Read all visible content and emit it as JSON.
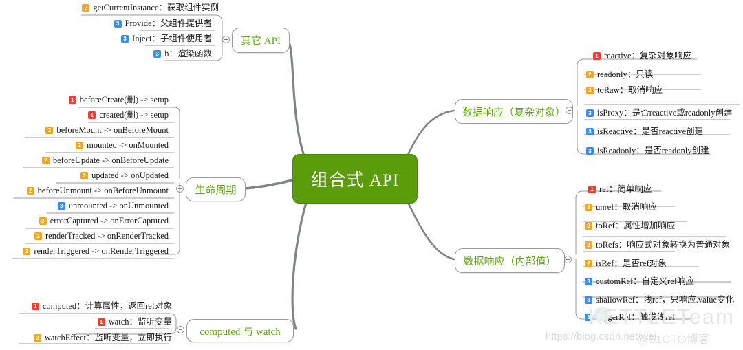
{
  "root": {
    "label": "组合式 API"
  },
  "colors": {
    "root_bg": "#5a9c0a",
    "branch_text": "#62a80f",
    "badge_p1": "#ea3f35",
    "badge_p2": "#f4a623",
    "badge_p3": "#3b8cf0",
    "connector": "#7f8486"
  },
  "branches": [
    {
      "id": "other-api",
      "label": "其它 API",
      "side": "left",
      "items": [
        {
          "priority": "2",
          "text": "getCurrentInstance：获取组件实例"
        },
        {
          "priority": "3",
          "text": "Provide：父组件提供者"
        },
        {
          "priority": "3",
          "text": "Inject：子组件使用者"
        },
        {
          "priority": "3",
          "text": "h：渲染函数"
        }
      ]
    },
    {
      "id": "lifecycle",
      "label": "生命周期",
      "side": "left",
      "items": [
        {
          "priority": "1",
          "text": "beforeCreate(删) -> setup"
        },
        {
          "priority": "1",
          "text": "created(删) -> setup"
        },
        {
          "priority": "2",
          "text": "beforeMount -> onBeforeMount"
        },
        {
          "priority": "2",
          "text": "mounted -> onMounted"
        },
        {
          "priority": "2",
          "text": "beforeUpdate -> onBeforeUpdate"
        },
        {
          "priority": "2",
          "text": "updated -> onUpdated"
        },
        {
          "priority": "2",
          "text": "beforeUnmount -> onBeforeUnmount"
        },
        {
          "priority": "3",
          "text": "unmounted -> onUnmounted"
        },
        {
          "priority": "2",
          "text": "errorCaptured -> onErrorCaptured"
        },
        {
          "priority": "2",
          "text": "renderTracked -> onRenderTracked"
        },
        {
          "priority": "2",
          "text": "renderTriggered -> onRenderTriggered"
        }
      ]
    },
    {
      "id": "computed-watch",
      "label": "computed 与 watch",
      "side": "left",
      "items": [
        {
          "priority": "1",
          "text": "computed：计算属性，返回ref对象"
        },
        {
          "priority": "1",
          "text": "watch：监听变量"
        },
        {
          "priority": "2",
          "text": "watchEffect：监听变量，立即执行"
        }
      ]
    },
    {
      "id": "reactive-object",
      "label": "数据响应（复杂对象）",
      "side": "right",
      "items": [
        {
          "priority": "1",
          "text": "reactive：复杂对象响应"
        },
        {
          "priority": "2",
          "text": "readonly：只读"
        },
        {
          "priority": "2",
          "text": "toRaw：取消响应"
        },
        {
          "priority": "3",
          "text": "isProxy：是否reactive或readonly创建"
        },
        {
          "priority": "3",
          "text": "isReactive：是否reactive创建"
        },
        {
          "priority": "3",
          "text": "isReadonly：是否readonly创建"
        }
      ]
    },
    {
      "id": "reactive-value",
      "label": "数据响应（内部值）",
      "side": "right",
      "items": [
        {
          "priority": "1",
          "text": "ref：简单响应"
        },
        {
          "priority": "2",
          "text": "unref：取消响应"
        },
        {
          "priority": "2",
          "text": "toRef：属性增加响应"
        },
        {
          "priority": "2",
          "text": "toRefs：响应式对象转换为普通对象"
        },
        {
          "priority": "2",
          "text": "isRef：是否ref对象"
        },
        {
          "priority": "3",
          "text": "customRef：自定义ref响应"
        },
        {
          "priority": "3",
          "text": "shallowRef：浅ref，只响应.value变化"
        },
        {
          "priority": "3",
          "text": "triggerRef：触发浅ref"
        }
      ]
    }
  ],
  "watermarks": {
    "csdn": "https://blog.csdn.net/wei",
    "cto": "@51CTO博客",
    "kettle": "KETTLETeam"
  }
}
